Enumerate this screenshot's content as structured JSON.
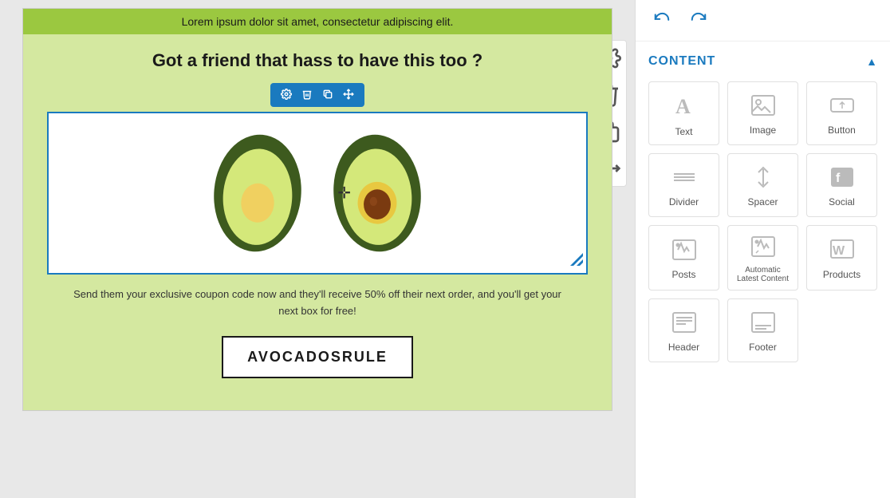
{
  "canvas": {
    "banner_text": "Lorem ipsum dolor sit amet, consectetur adipiscing elit.",
    "heading": "Got a friend that hass to have this too ?",
    "body_text": "Send them your exclusive coupon code now and they'll receive 50% off their next order, and you'll get your next box for free!",
    "coupon_code": "AVOCADOSRULE"
  },
  "toolbar": {
    "undo_label": "↩",
    "redo_label": "↪"
  },
  "panel": {
    "section_title": "CONTENT",
    "collapse_icon": "▲"
  },
  "content_items": [
    {
      "id": "text",
      "label": "Text"
    },
    {
      "id": "image",
      "label": "Image"
    },
    {
      "id": "button",
      "label": "Button"
    },
    {
      "id": "divider",
      "label": "Divider"
    },
    {
      "id": "spacer",
      "label": "Spacer"
    },
    {
      "id": "social",
      "label": "Social"
    },
    {
      "id": "posts",
      "label": "Posts"
    },
    {
      "id": "alc",
      "label": "Automatic Latest Content"
    },
    {
      "id": "products",
      "label": "Products"
    },
    {
      "id": "header",
      "label": "Header"
    },
    {
      "id": "footer",
      "label": "Footer"
    }
  ],
  "block_toolbar_icons": [
    "⚙",
    "🗑",
    "⧉",
    "✥"
  ],
  "canvas_side_icons": [
    "⚙",
    "🗑",
    "⧉",
    "✥"
  ]
}
